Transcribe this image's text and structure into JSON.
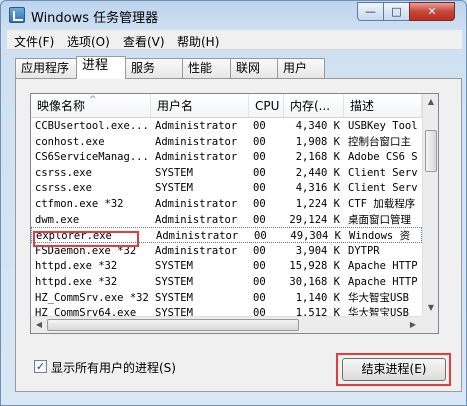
{
  "window": {
    "title": "Windows 任务管理器",
    "controls": {
      "minimize": "—",
      "maximize": "□",
      "close": "✕"
    }
  },
  "menu": [
    "文件(F)",
    "选项(O)",
    "查看(V)",
    "帮助(H)"
  ],
  "tabs": [
    "应用程序",
    "进程",
    "服务",
    "性能",
    "联网",
    "用户"
  ],
  "active_tab": "进程",
  "columns": [
    "映像名称",
    "用户名",
    "CPU",
    "内存(...",
    "描述"
  ],
  "rows": [
    [
      "CCBUsertool.exe...",
      "Administrator",
      "00",
      "4,340 K",
      "USBKey Tool"
    ],
    [
      "conhost.exe",
      "Administrator",
      "00",
      "1,908 K",
      "控制台窗口主"
    ],
    [
      "CS6ServiceManag...",
      "Administrator",
      "00",
      "2,168 K",
      "Adobe CS6 S"
    ],
    [
      "csrss.exe",
      "SYSTEM",
      "00",
      "2,440 K",
      "Client Serv"
    ],
    [
      "csrss.exe",
      "SYSTEM",
      "00",
      "4,316 K",
      "Client Serv"
    ],
    [
      "ctfmon.exe *32",
      "Administrator",
      "00",
      "1,224 K",
      "CTF 加载程序"
    ],
    [
      "dwm.exe",
      "Administrator",
      "00",
      "29,124 K",
      "桌面窗口管理"
    ],
    [
      "explorer.exe",
      "Administrator",
      "00",
      "49,304 K",
      "Windows 资"
    ],
    [
      "FSDaemon.exe *32",
      "Administrator",
      "00",
      "3,904 K",
      "DYTPR"
    ],
    [
      "httpd.exe *32",
      "SYSTEM",
      "00",
      "15,928 K",
      "Apache HTTP"
    ],
    [
      "httpd.exe *32",
      "SYSTEM",
      "00",
      "30,168 K",
      "Apache HTTP"
    ],
    [
      "HZ_CommSrv.exe *32",
      "SYSTEM",
      "00",
      "1,140 K",
      "华大智宝USB"
    ],
    [
      "HZ_CommSrv64.exe",
      "SYSTEM",
      "00",
      "1,512 K",
      "华大智宝USB"
    ]
  ],
  "selected_row_index": 7,
  "show_all_users_label": "显示所有用户的进程(S)",
  "show_all_users_checked": true,
  "end_process_label": "结束进程(E)",
  "icons": {
    "process": "process-icon",
    "app": "task-manager-icon"
  },
  "colors": {
    "highlight": "#e43b3b",
    "title_bg": "#bcd4ee"
  }
}
